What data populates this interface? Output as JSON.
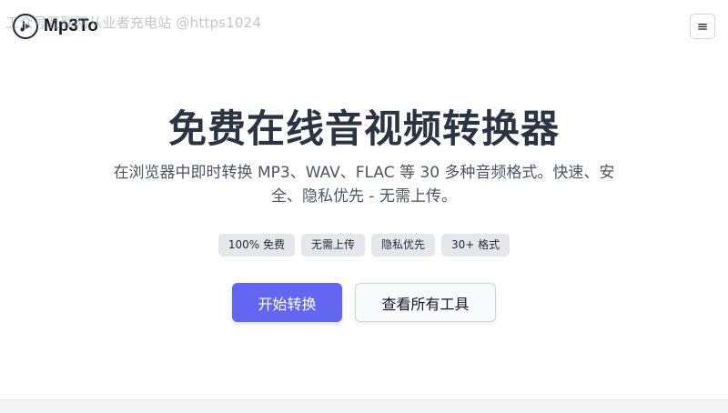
{
  "watermark": "工众号互联网从业者充电站 @https1024",
  "header": {
    "logo_text": "Mp3To",
    "menu_glyph": "≡",
    "logo_icon": "play-note-icon",
    "menu_icon": "hamburger-menu-icon"
  },
  "hero": {
    "title": "免费在线音视频转换器",
    "subtitle": "在浏览器中即时转换 MP3、WAV、FLAC 等 30 多种音频格式。快速、安全、隐私优先 - 无需上传。"
  },
  "badges": [
    "100% 免费",
    "无需上传",
    "隐私优先",
    "30+ 格式"
  ],
  "actions": {
    "primary_label": "开始转换",
    "secondary_label": "查看所有工具"
  },
  "colors": {
    "accent": "#6366f1",
    "title": "#2b3442",
    "badge_bg": "#e5e7eb"
  }
}
